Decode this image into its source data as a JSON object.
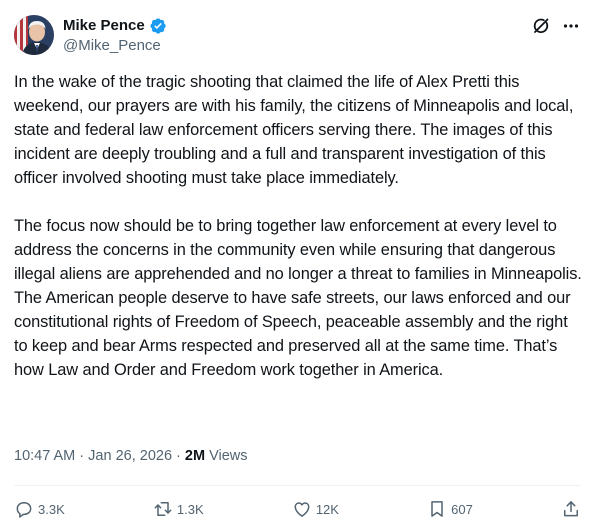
{
  "author": {
    "name": "Mike Pence",
    "handle": "@Mike_Pence"
  },
  "tweet": {
    "paragraphs": [
      "In the wake of the tragic shooting that claimed the life of Alex Pretti this weekend, our prayers are with his family, the citizens of Minneapolis and local, state and federal law enforcement officers serving there. The images of this incident are deeply troubling and a full and transparent investigation of this officer involved shooting must take place immediately.",
      "The focus now should be to bring together law enforcement at every level to address the concerns in the community even while ensuring that dangerous illegal aliens are apprehended and no longer a threat to families in Minneapolis. The American people deserve to have safe streets, our laws enforced and our constitutional rights of Freedom of Speech, peaceable assembly and the right to keep and bear Arms respected and preserved all at the same time. That’s how Law and Order and Freedom work together in America."
    ],
    "time": "10:47 AM",
    "date": "Jan 26, 2026",
    "separator": " · ",
    "views_count": "2M",
    "views_label": "Views"
  },
  "actions": {
    "replies": "3.3K",
    "reposts": "1.3K",
    "likes": "12K",
    "bookmarks": "607"
  },
  "colors": {
    "text": "#0f1419",
    "secondary": "#536471",
    "verified": "#1d9bf0",
    "divider": "#eff3f4"
  },
  "icons": [
    "verified-badge-icon",
    "grok-icon",
    "more-icon",
    "reply-icon",
    "repost-icon",
    "like-icon",
    "bookmark-icon",
    "share-icon"
  ]
}
